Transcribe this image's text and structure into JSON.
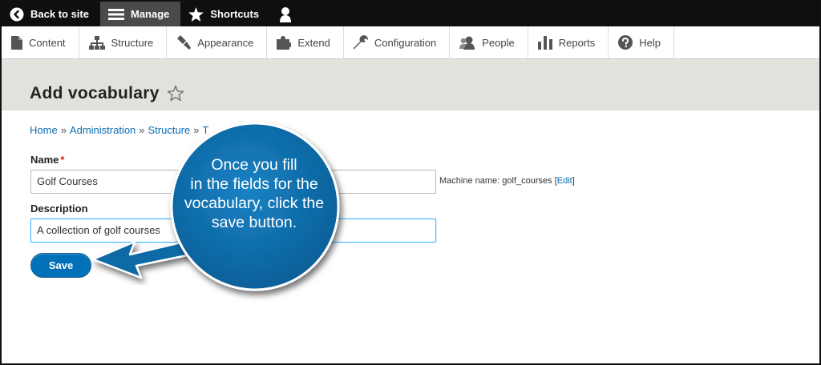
{
  "toolbar": {
    "back_label": "Back to site",
    "manage_label": "Manage",
    "shortcuts_label": "Shortcuts"
  },
  "menu": {
    "content": "Content",
    "structure": "Structure",
    "appearance": "Appearance",
    "extend": "Extend",
    "configuration": "Configuration",
    "people": "People",
    "reports": "Reports",
    "help": "Help"
  },
  "page": {
    "title": "Add vocabulary"
  },
  "breadcrumb": {
    "home": "Home",
    "administration": "Administration",
    "structure": "Structure",
    "taxonomy_partial": "T",
    "separator": "»"
  },
  "form": {
    "name_label": "Name",
    "name_required": "*",
    "name_value": "Golf Courses",
    "machine_name_prefix": "Machine name: golf_courses [",
    "machine_name_edit": "Edit",
    "machine_name_suffix": "]",
    "description_label": "Description",
    "description_value": "A collection of golf courses",
    "save_label": "Save"
  },
  "callout": {
    "line1": "Once you fill",
    "line2": "in the fields for the",
    "line3": "vocabulary, click the",
    "line4": "save button."
  },
  "colors": {
    "toolbar_bg": "#0f0f0f",
    "header_bg": "#e2e1db",
    "link": "#0a6eb4",
    "primary_button": "#0071b8",
    "callout_fill": "#0a6aa6",
    "required": "#e32700"
  }
}
